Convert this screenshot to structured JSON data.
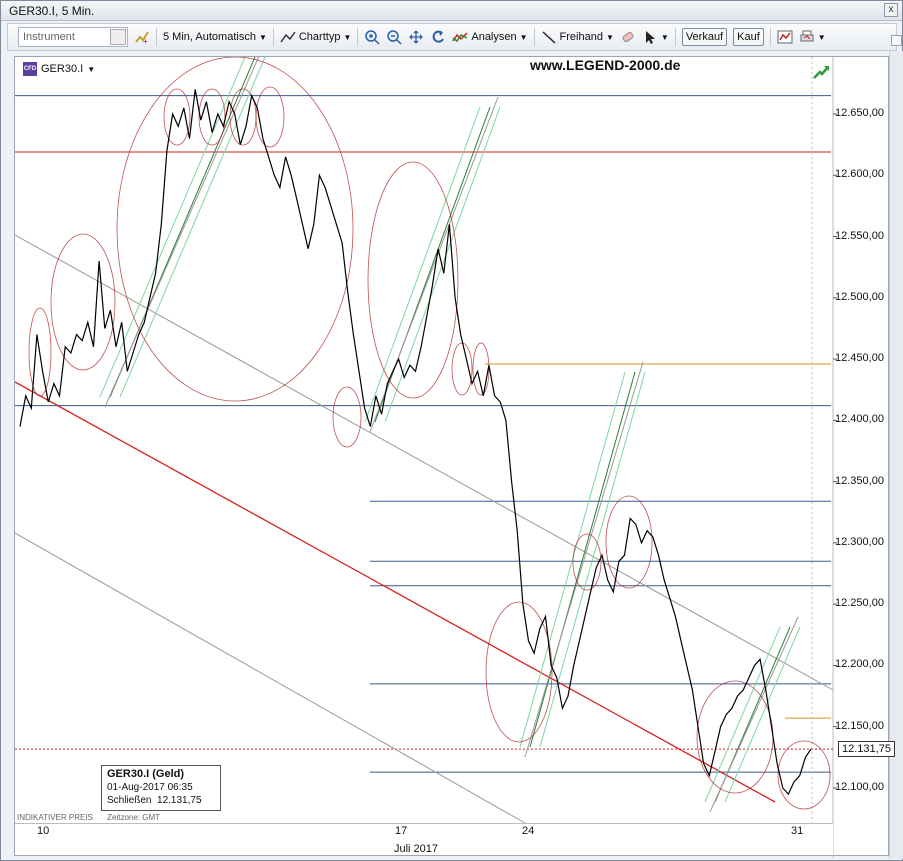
{
  "window": {
    "title": "GER30.I, 5 Min.",
    "close_glyph": "x"
  },
  "toolbar": {
    "instrument_placeholder": "Instrument",
    "interval_label": "5 Min,  Automatisch",
    "charttype_label": "Charttyp",
    "analysen_label": "Analysen",
    "freihand_label": "Freihand",
    "verkauf_label": "Verkauf",
    "kauf_label": "Kauf"
  },
  "chart": {
    "symbol": "GER30.I",
    "brand": "www.LEGEND-2000.de",
    "legend": {
      "title": "GER30.I (Geld)",
      "datetime": "01-Aug-2017 06:35",
      "close_label": "Schließen",
      "close_value": "12.131,75"
    },
    "footer_left": "INDIKATIVER PREIS",
    "footer_tz": "Zeitzone: GMT",
    "last_price": "12.131,75",
    "month_label": "Juli 2017",
    "colors": {
      "price": "#000000",
      "red_line": "#d62020",
      "blue_line": "#3a5a8a",
      "orange_line": "#d9902a",
      "grey_line": "#999999",
      "green_line": "#2e7d32",
      "lightgreen": "#7fd6a0",
      "circle": "#b22222"
    }
  },
  "chart_data": {
    "type": "line",
    "title": "",
    "xlabel": "",
    "ylabel": "",
    "ylim": [
      12060,
      12720
    ],
    "x_ticks": [
      "10",
      "17",
      "24",
      "31"
    ],
    "y_ticks": [
      "12.650,00",
      "12.600,00",
      "12.550,00",
      "12.500,00",
      "12.450,00",
      "12.400,00",
      "12.350,00",
      "12.300,00",
      "12.250,00",
      "12.200,00",
      "12.150,00",
      "12.100,00"
    ],
    "y_tick_values": [
      12650,
      12600,
      12550,
      12500,
      12450,
      12400,
      12350,
      12300,
      12250,
      12200,
      12150,
      12100
    ],
    "series": [
      {
        "values": [
          12395,
          12420,
          12410,
          12470,
          12440,
          12415,
          12430,
          12420,
          12460,
          12455,
          12470,
          12465,
          12480,
          12460,
          12530,
          12475,
          12490,
          12460,
          12480,
          12440,
          12455,
          12470,
          12480,
          12500,
          12520,
          12560,
          12620,
          12650,
          12640,
          12655,
          12630,
          12670,
          12645,
          12660,
          12635,
          12650,
          12640,
          12660,
          12650,
          12625,
          12640,
          12665,
          12655,
          12630,
          12615,
          12600,
          12590,
          12615,
          12600,
          12580,
          12560,
          12540,
          12560,
          12600,
          12590,
          12575,
          12560,
          12545,
          12505,
          12470,
          12440,
          12410,
          12395,
          12420,
          12405,
          12430,
          12440,
          12450,
          12435,
          12445,
          12440,
          12460,
          12485,
          12510,
          12540,
          12520,
          12560,
          12500,
          12470,
          12450,
          12430,
          12440,
          12420,
          12445,
          12420,
          12415,
          12400,
          12350,
          12310,
          12250,
          12220,
          12210,
          12230,
          12240,
          12200,
          12190,
          12165,
          12175,
          12200,
          12220,
          12240,
          12260,
          12280,
          12290,
          12270,
          12260,
          12285,
          12290,
          12320,
          12315,
          12300,
          12310,
          12305,
          12290,
          12270,
          12255,
          12240,
          12220,
          12200,
          12180,
          12150,
          12120,
          12110,
          12130,
          12150,
          12160,
          12165,
          12175,
          12180,
          12190,
          12200,
          12205,
          12180,
          12150,
          12120,
          12100,
          12095,
          12105,
          12110,
          12125,
          12131.75
        ]
      }
    ],
    "horizontal_levels": [
      {
        "value": 12665,
        "color": "#3a5a8a"
      },
      {
        "value": 12619,
        "color": "#d62020"
      },
      {
        "value": 12446,
        "color": "#d9902a"
      },
      {
        "value": 12412,
        "color": "#3a5a8a"
      },
      {
        "value": 12334,
        "color": "#3a5a8a"
      },
      {
        "value": 12285,
        "color": "#3a5a8a"
      },
      {
        "value": 12265,
        "color": "#3a5a8a"
      },
      {
        "value": 12185,
        "color": "#3a5a8a"
      },
      {
        "value": 12157,
        "color": "#d9902a"
      },
      {
        "value": 12113,
        "color": "#3a5a8a"
      }
    ]
  }
}
